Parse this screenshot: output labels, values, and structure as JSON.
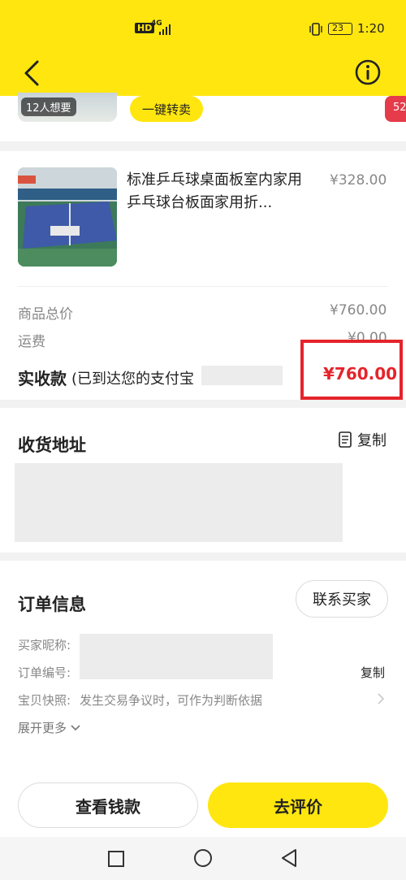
{
  "status_bar": {
    "hd": "HD",
    "net": "4G",
    "battery": "23",
    "time": "1:20"
  },
  "header": {
    "back_icon": "chevron-left-icon",
    "info_icon": "info-circle-icon"
  },
  "top_strip": {
    "want_count": "12人想要",
    "resell_label": "一键转卖",
    "right_badge": "52"
  },
  "item": {
    "title": "标准乒乓球桌面板室内家用乒乓球台板面家用折...",
    "price": "¥328.00"
  },
  "summary": {
    "goods_total_label": "商品总价",
    "goods_total_value": "¥760.00",
    "shipping_label": "运费",
    "shipping_value": "¥0.00",
    "received_label": "实收款",
    "received_note": "(已到达您的支付宝",
    "received_value": "¥760.00",
    "accent_color": "#e5242b"
  },
  "address": {
    "title": "收货地址",
    "copy_label": "复制",
    "copy_icon": "document-copy-icon"
  },
  "order": {
    "title": "订单信息",
    "contact_buyer": "联系买家",
    "buyer_nick_label": "买家昵称:",
    "order_no_label": "订单编号:",
    "order_no_copy": "复制",
    "snapshot_label": "宝贝快照:",
    "snapshot_text": "发生交易争议时，可作为判断依据",
    "expand_more": "展开更多"
  },
  "bottom": {
    "view_money": "查看钱款",
    "review": "去评价"
  },
  "nav": {
    "square_icon": "recent-apps-icon",
    "circle_icon": "home-icon",
    "back_icon": "triangle-back-icon"
  }
}
